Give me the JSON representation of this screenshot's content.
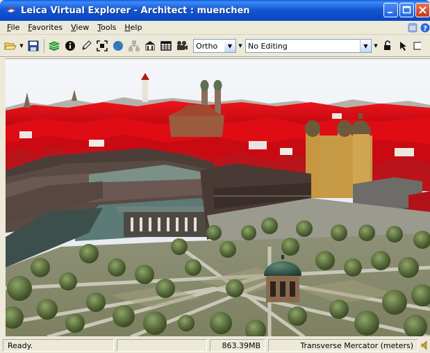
{
  "window": {
    "title": "Leica Virtual Explorer - Architect : muenchen"
  },
  "menu": [
    {
      "label": "File",
      "mnemonic": "F",
      "rest": "ile"
    },
    {
      "label": "Favorites",
      "mnemonic": "F",
      "rest": "avorites"
    },
    {
      "label": "View",
      "mnemonic": "V",
      "rest": "iew"
    },
    {
      "label": "Tools",
      "mnemonic": "T",
      "rest": "ools"
    },
    {
      "label": "Help",
      "mnemonic": "H",
      "rest": "elp"
    }
  ],
  "toolbar": {
    "projection_value": "Ortho",
    "editing_value": "No Editing"
  },
  "status": {
    "ready": "Ready.",
    "empty": "",
    "memory": "863.39MB",
    "coordinate_system": "Transverse Mercator (meters)"
  },
  "colors": {
    "title_bar": "#0b4bc8",
    "roof_red": "#e00c14",
    "sky": "#e9eef5",
    "grass": "#6f7a4a"
  },
  "icons": [
    "app-icon",
    "open-folder-icon",
    "save-icon",
    "layers-icon",
    "info-icon",
    "edit-pen-icon",
    "zoom-extent-icon",
    "globe-icon",
    "network-icon",
    "building-icon",
    "table-icon",
    "camera-icon",
    "lock-icon",
    "pointer-icon",
    "help-icon"
  ]
}
